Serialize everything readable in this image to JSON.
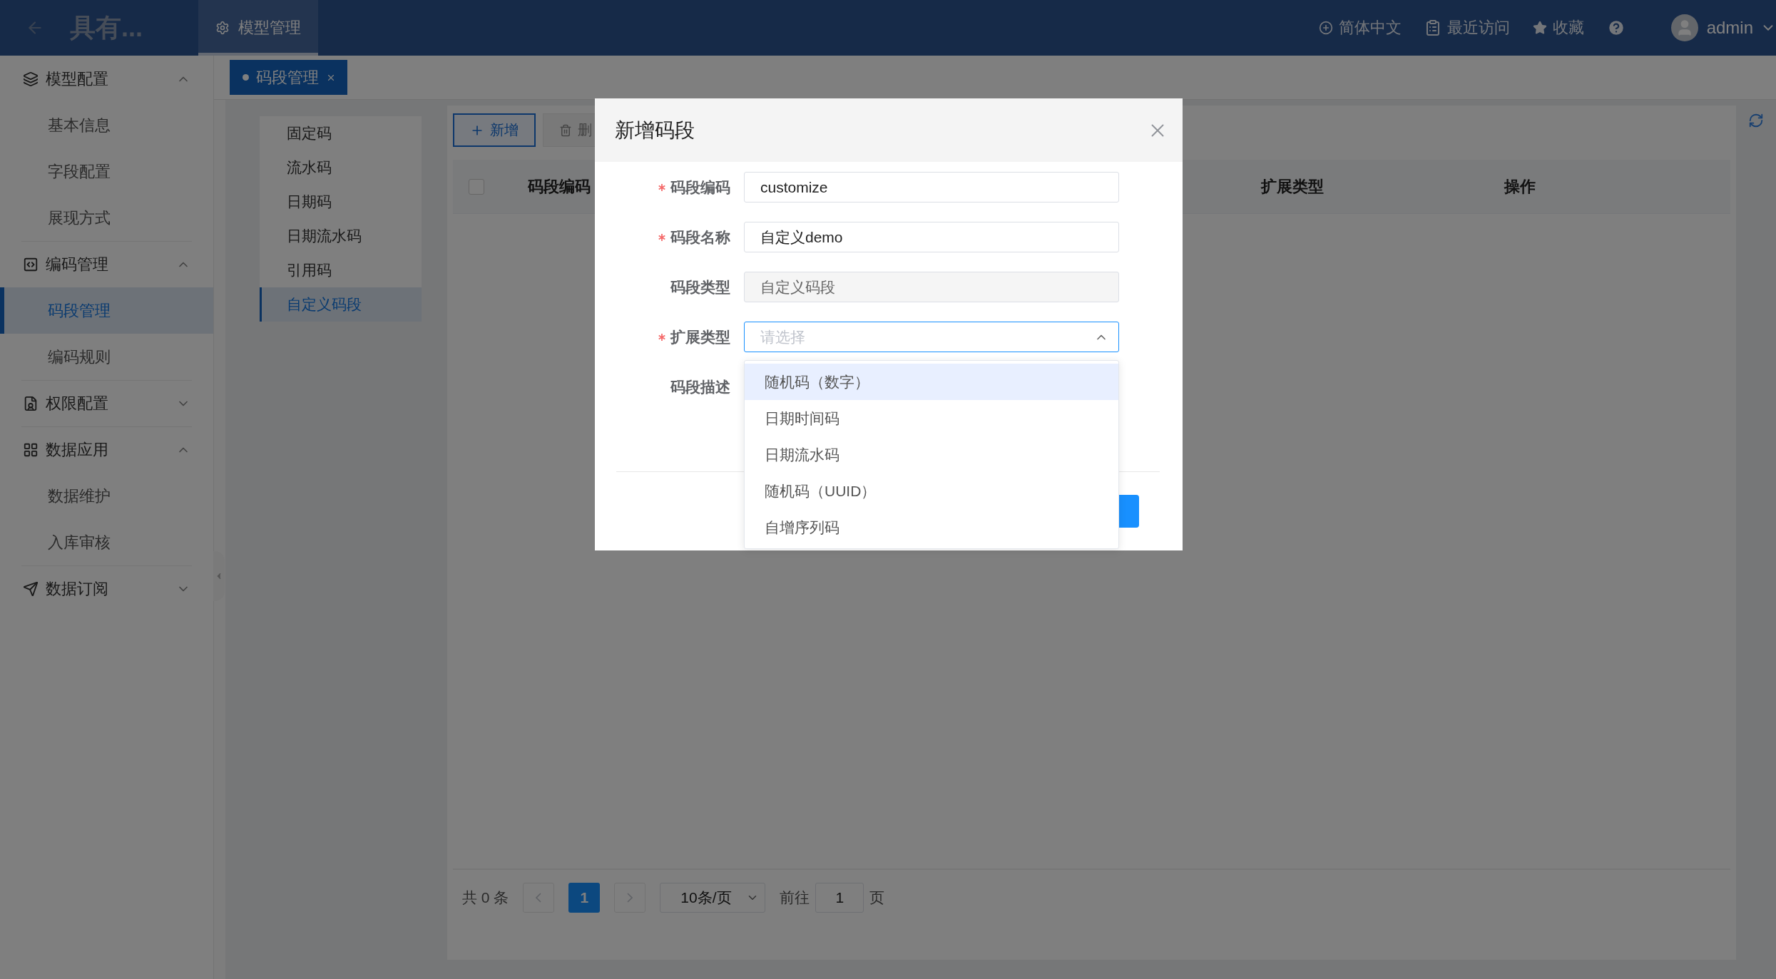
{
  "header": {
    "title": "具有...",
    "nav": [
      {
        "label": "模型管理",
        "selected": true
      }
    ],
    "tools": [
      {
        "kind": "language",
        "label": "简体中文"
      },
      {
        "kind": "recent",
        "label": "最近访问"
      },
      {
        "kind": "favorite",
        "label": "收藏"
      },
      {
        "kind": "help"
      }
    ],
    "user": "admin"
  },
  "tags": [
    {
      "label": "码段管理",
      "selected": true
    }
  ],
  "sidebar": {
    "groups": [
      {
        "kind": "model",
        "label": "模型配置",
        "expanded": true,
        "children": [
          {
            "label": "基本信息",
            "selected": false
          },
          {
            "label": "字段配置",
            "selected": false
          },
          {
            "label": "展现方式",
            "selected": false
          }
        ]
      },
      {
        "kind": "code",
        "label": "编码管理",
        "expanded": true,
        "children": [
          {
            "label": "码段管理",
            "selected": true
          },
          {
            "label": "编码规则",
            "selected": false
          }
        ]
      },
      {
        "kind": "permission",
        "label": "权限配置",
        "expanded": false
      },
      {
        "kind": "apps",
        "label": "数据应用",
        "expanded": true,
        "children": [
          {
            "label": "数据维护",
            "selected": false
          },
          {
            "label": "入库审核",
            "selected": false
          }
        ]
      },
      {
        "kind": "subscribe",
        "label": "数据订阅",
        "expanded": false
      }
    ]
  },
  "segment_types": [
    {
      "label": "固定码",
      "selected": false
    },
    {
      "label": "流水码",
      "selected": false
    },
    {
      "label": "日期码",
      "selected": false
    },
    {
      "label": "日期流水码",
      "selected": false
    },
    {
      "label": "引用码",
      "selected": false
    },
    {
      "label": "自定义码段",
      "selected": true
    }
  ],
  "toolbar": [
    {
      "kind": "add",
      "label": "新增",
      "disabled": false
    },
    {
      "kind": "delete",
      "label": "删",
      "disabled": true
    }
  ],
  "table": {
    "select_all_checked": false,
    "columns": [
      "码段编码",
      "扩展类型",
      "操作"
    ]
  },
  "pagination": {
    "total": "共 0 条",
    "pages": [
      {
        "label": "1",
        "selected": true
      }
    ],
    "page_size": "10条/页",
    "goto_label": "前往",
    "goto_value": "1",
    "page_unit": "页"
  },
  "dialog": {
    "title": "新增码段",
    "fields": [
      {
        "kind": "input",
        "label": "码段编码",
        "required": true,
        "disabled": false,
        "value": "customize"
      },
      {
        "kind": "input",
        "label": "码段名称",
        "required": true,
        "disabled": false,
        "value": "自定义demo"
      },
      {
        "kind": "input",
        "label": "码段类型",
        "required": false,
        "disabled": true,
        "value": "自定义码段"
      },
      {
        "kind": "select",
        "label": "扩展类型",
        "required": true,
        "placeholder": "请选择",
        "expanded": true,
        "options": [
          {
            "label": "随机码（数字）",
            "selected": true
          },
          {
            "label": "日期时间码",
            "selected": false
          },
          {
            "label": "日期流水码",
            "selected": false
          },
          {
            "label": "随机码（UUID）",
            "selected": false
          },
          {
            "label": "自增序列码",
            "selected": false
          }
        ]
      },
      {
        "kind": "textarea",
        "label": "码段描述",
        "required": false
      }
    ]
  }
}
